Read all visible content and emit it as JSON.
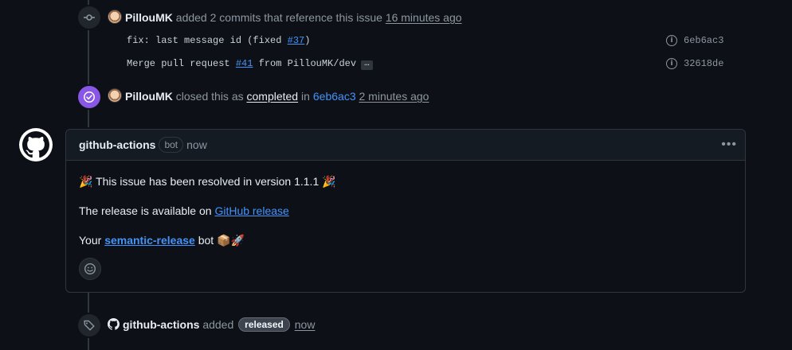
{
  "events": {
    "commits_event": {
      "author": "PillouMK",
      "text": "added 2 commits that reference this issue",
      "time": "16 minutes ago",
      "commits": [
        {
          "message_prefix": "fix: last message id (fixed ",
          "ref": "#37",
          "message_suffix": ")",
          "sha": "6eb6ac3"
        },
        {
          "message_prefix": "Merge pull request ",
          "ref": "#41",
          "message_suffix": " from PillouMK/dev",
          "more": "…",
          "sha": "32618de"
        }
      ]
    },
    "closed_event": {
      "author": "PillouMK",
      "text_before": "closed this as",
      "status": "completed",
      "text_in": "in",
      "commit": "6eb6ac3",
      "time": "2 minutes ago"
    },
    "label_event": {
      "author": "github-actions",
      "text": "added",
      "label": "released",
      "time": "now"
    }
  },
  "comment": {
    "author": "github-actions",
    "badge": "bot",
    "time": "now",
    "line1": "🎉 This issue has been resolved in version 1.1.1 🎉",
    "line2_prefix": "The release is available on ",
    "line2_link": "GitHub release",
    "line3_prefix": "Your ",
    "line3_link": "semantic-release",
    "line3_suffix": " bot 📦🚀"
  },
  "icons": {
    "commit": "git-commit-icon",
    "closed": "check-circle-icon",
    "tag": "tag-icon",
    "more": "kebab-horizontal-icon",
    "emoji": "smiley-icon",
    "info": "info-icon",
    "github": "github-mark-icon"
  },
  "colors": {
    "background": "#0d1117",
    "link": "#4493f8",
    "closed_badge": "#8957e5",
    "border": "#30363d"
  }
}
